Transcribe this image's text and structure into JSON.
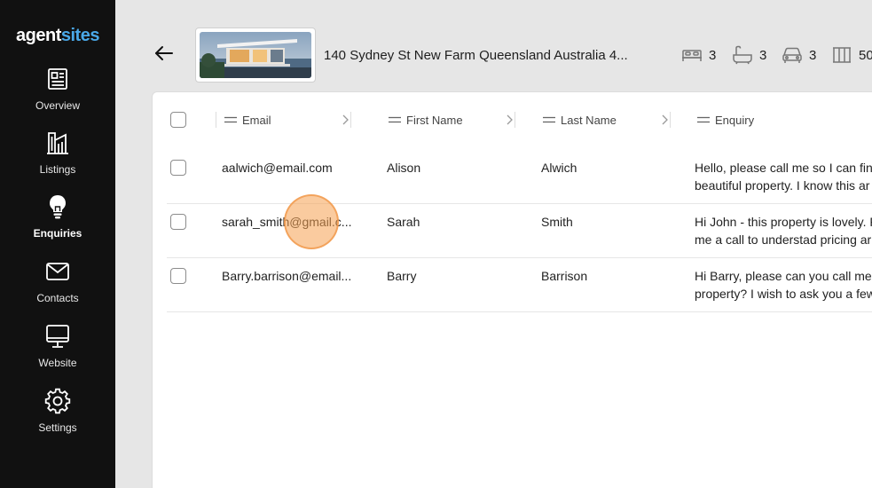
{
  "brand": {
    "part1": "agent",
    "part2": "sites",
    "accent": "#4aa8e8"
  },
  "sidebar": {
    "items": [
      {
        "label": "Overview",
        "icon": "overview-icon"
      },
      {
        "label": "Listings",
        "icon": "listings-icon"
      },
      {
        "label": "Enquiries",
        "icon": "lightbulb-icon",
        "active": true
      },
      {
        "label": "Contacts",
        "icon": "envelope-icon"
      },
      {
        "label": "Website",
        "icon": "monitor-icon"
      },
      {
        "label": "Settings",
        "icon": "gear-icon"
      }
    ]
  },
  "property": {
    "address": "140 Sydney St New Farm Queensland Australia 4...",
    "bedrooms": "3",
    "bathrooms": "3",
    "car_spaces": "3",
    "land_size": "50"
  },
  "table": {
    "columns": [
      "Email",
      "First Name",
      "Last Name",
      "Enquiry"
    ],
    "rows": [
      {
        "email": "aalwich@email.com",
        "first_name": "Alison",
        "last_name": "Alwich",
        "enquiry_line1": "Hello, please call me so I can fin",
        "enquiry_line2": "beautiful property. I know this ar"
      },
      {
        "email": "sarah_smith@gmail.c...",
        "first_name": "Sarah",
        "last_name": "Smith",
        "enquiry_line1": "Hi John - this property is lovely. P",
        "enquiry_line2": "me a call to understad pricing ar"
      },
      {
        "email": "Barry.barrison@email...",
        "first_name": "Barry",
        "last_name": "Barrison",
        "enquiry_line1": "Hi Barry, please can you call me",
        "enquiry_line2": "property? I wish to ask you a few"
      }
    ]
  }
}
